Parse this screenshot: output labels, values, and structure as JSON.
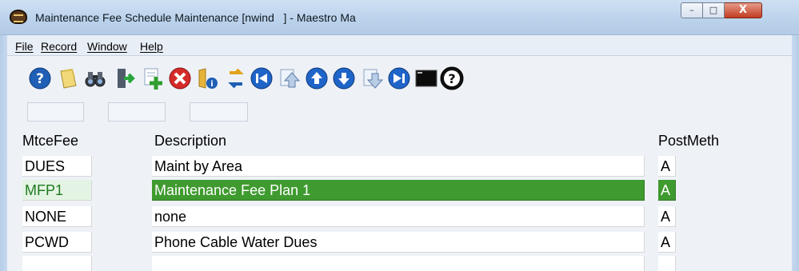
{
  "window": {
    "title": "Maintenance Fee Schedule Maintenance [nwind   ] - Maestro Ma",
    "minimize_glyph": "–",
    "maximize_glyph": "□",
    "close_glyph": "X"
  },
  "menu": [
    "File",
    "Record",
    "Window",
    "Help"
  ],
  "toolbar": {
    "buttons": [
      "help-icon",
      "notepad-icon",
      "find-binoculars-icon",
      "exit-door-icon",
      "add-record-icon",
      "delete-record-icon",
      "folder-info-icon",
      "refresh-icon",
      "first-record-icon",
      "page-up-icon",
      "previous-record-icon",
      "next-record-icon",
      "page-down-icon",
      "last-record-icon",
      "console-icon",
      "about-icon"
    ]
  },
  "grid": {
    "headers": {
      "code": "MtceFee",
      "description": "Description",
      "post": "PostMeth"
    },
    "rows": [
      {
        "code": "DUES",
        "description": "Maint by Area",
        "post": "A",
        "selected": false
      },
      {
        "code": "MFP1",
        "description": "Maintenance Fee Plan 1",
        "post": "A",
        "selected": true
      },
      {
        "code": "NONE",
        "description": "none",
        "post": "A",
        "selected": false
      },
      {
        "code": "PCWD",
        "description": "Phone Cable Water Dues",
        "post": "A",
        "selected": false
      },
      {
        "code": "",
        "description": "",
        "post": "",
        "selected": false
      }
    ]
  },
  "colors": {
    "selected_row": "#3f9a2f",
    "selected_code_bg": "#e4f4e4",
    "toolbar_bg": "#eef2f7",
    "titlebar": "#bcd3ec"
  }
}
